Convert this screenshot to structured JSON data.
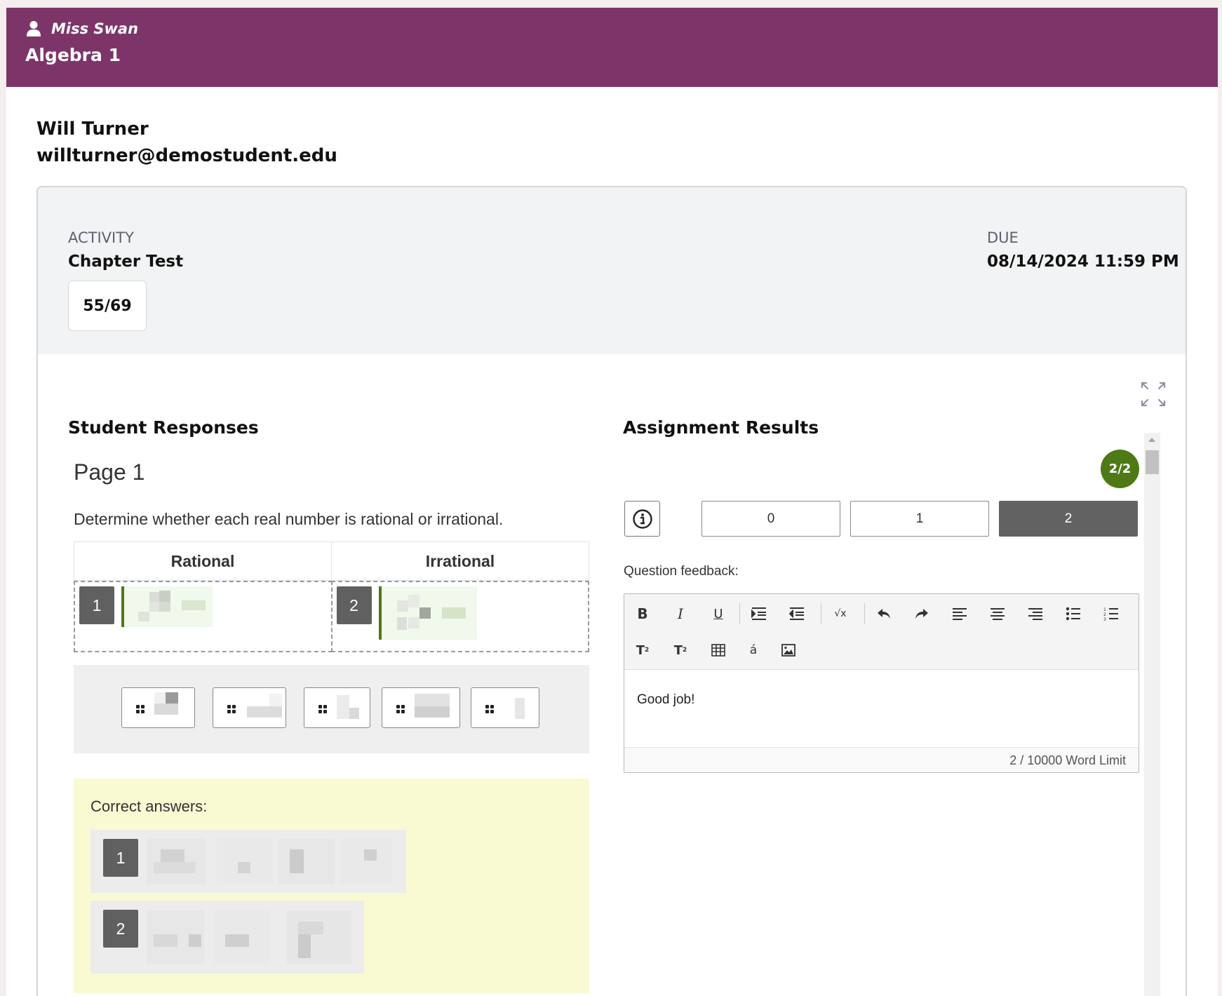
{
  "header": {
    "teacher_name": "Miss Swan",
    "course_title": "Algebra 1",
    "brand_color": "#7d3569"
  },
  "student": {
    "name": "Will Turner",
    "email": "willturner@demostudent.edu"
  },
  "activity": {
    "label": "ACTIVITY",
    "name": "Chapter Test",
    "due_label": "DUE",
    "due_value": "08/14/2024 11:59 PM",
    "score": "55/69"
  },
  "student_responses": {
    "title": "Student Responses",
    "page_title": "Page 1",
    "question": "Determine whether each real number is rational or irrational.",
    "columns": [
      "Rational",
      "Irrational"
    ],
    "drop_badges": [
      "1",
      "2"
    ],
    "correct_label": "Correct answers:",
    "correct_badges": [
      "1",
      "2"
    ]
  },
  "assignment_results": {
    "title": "Assignment Results",
    "score_pill": "2/2",
    "score_pill_color": "#4d7a15",
    "points_options": [
      "0",
      "1",
      "2"
    ],
    "selected_points": "2",
    "feedback_label": "Question feedback:",
    "feedback_text": "Good job!",
    "word_count": "2 / 10000 Word Limit",
    "toolbar_icons": [
      "bold-icon",
      "italic-icon",
      "underline-icon",
      "indent-icon",
      "outdent-icon",
      "math-icon",
      "undo-icon",
      "redo-icon",
      "align-left-icon",
      "align-center-icon",
      "align-right-icon",
      "bullet-list-icon",
      "numbered-list-icon",
      "superscript-icon",
      "subscript-icon",
      "table-icon",
      "special-char-icon",
      "image-icon"
    ]
  }
}
